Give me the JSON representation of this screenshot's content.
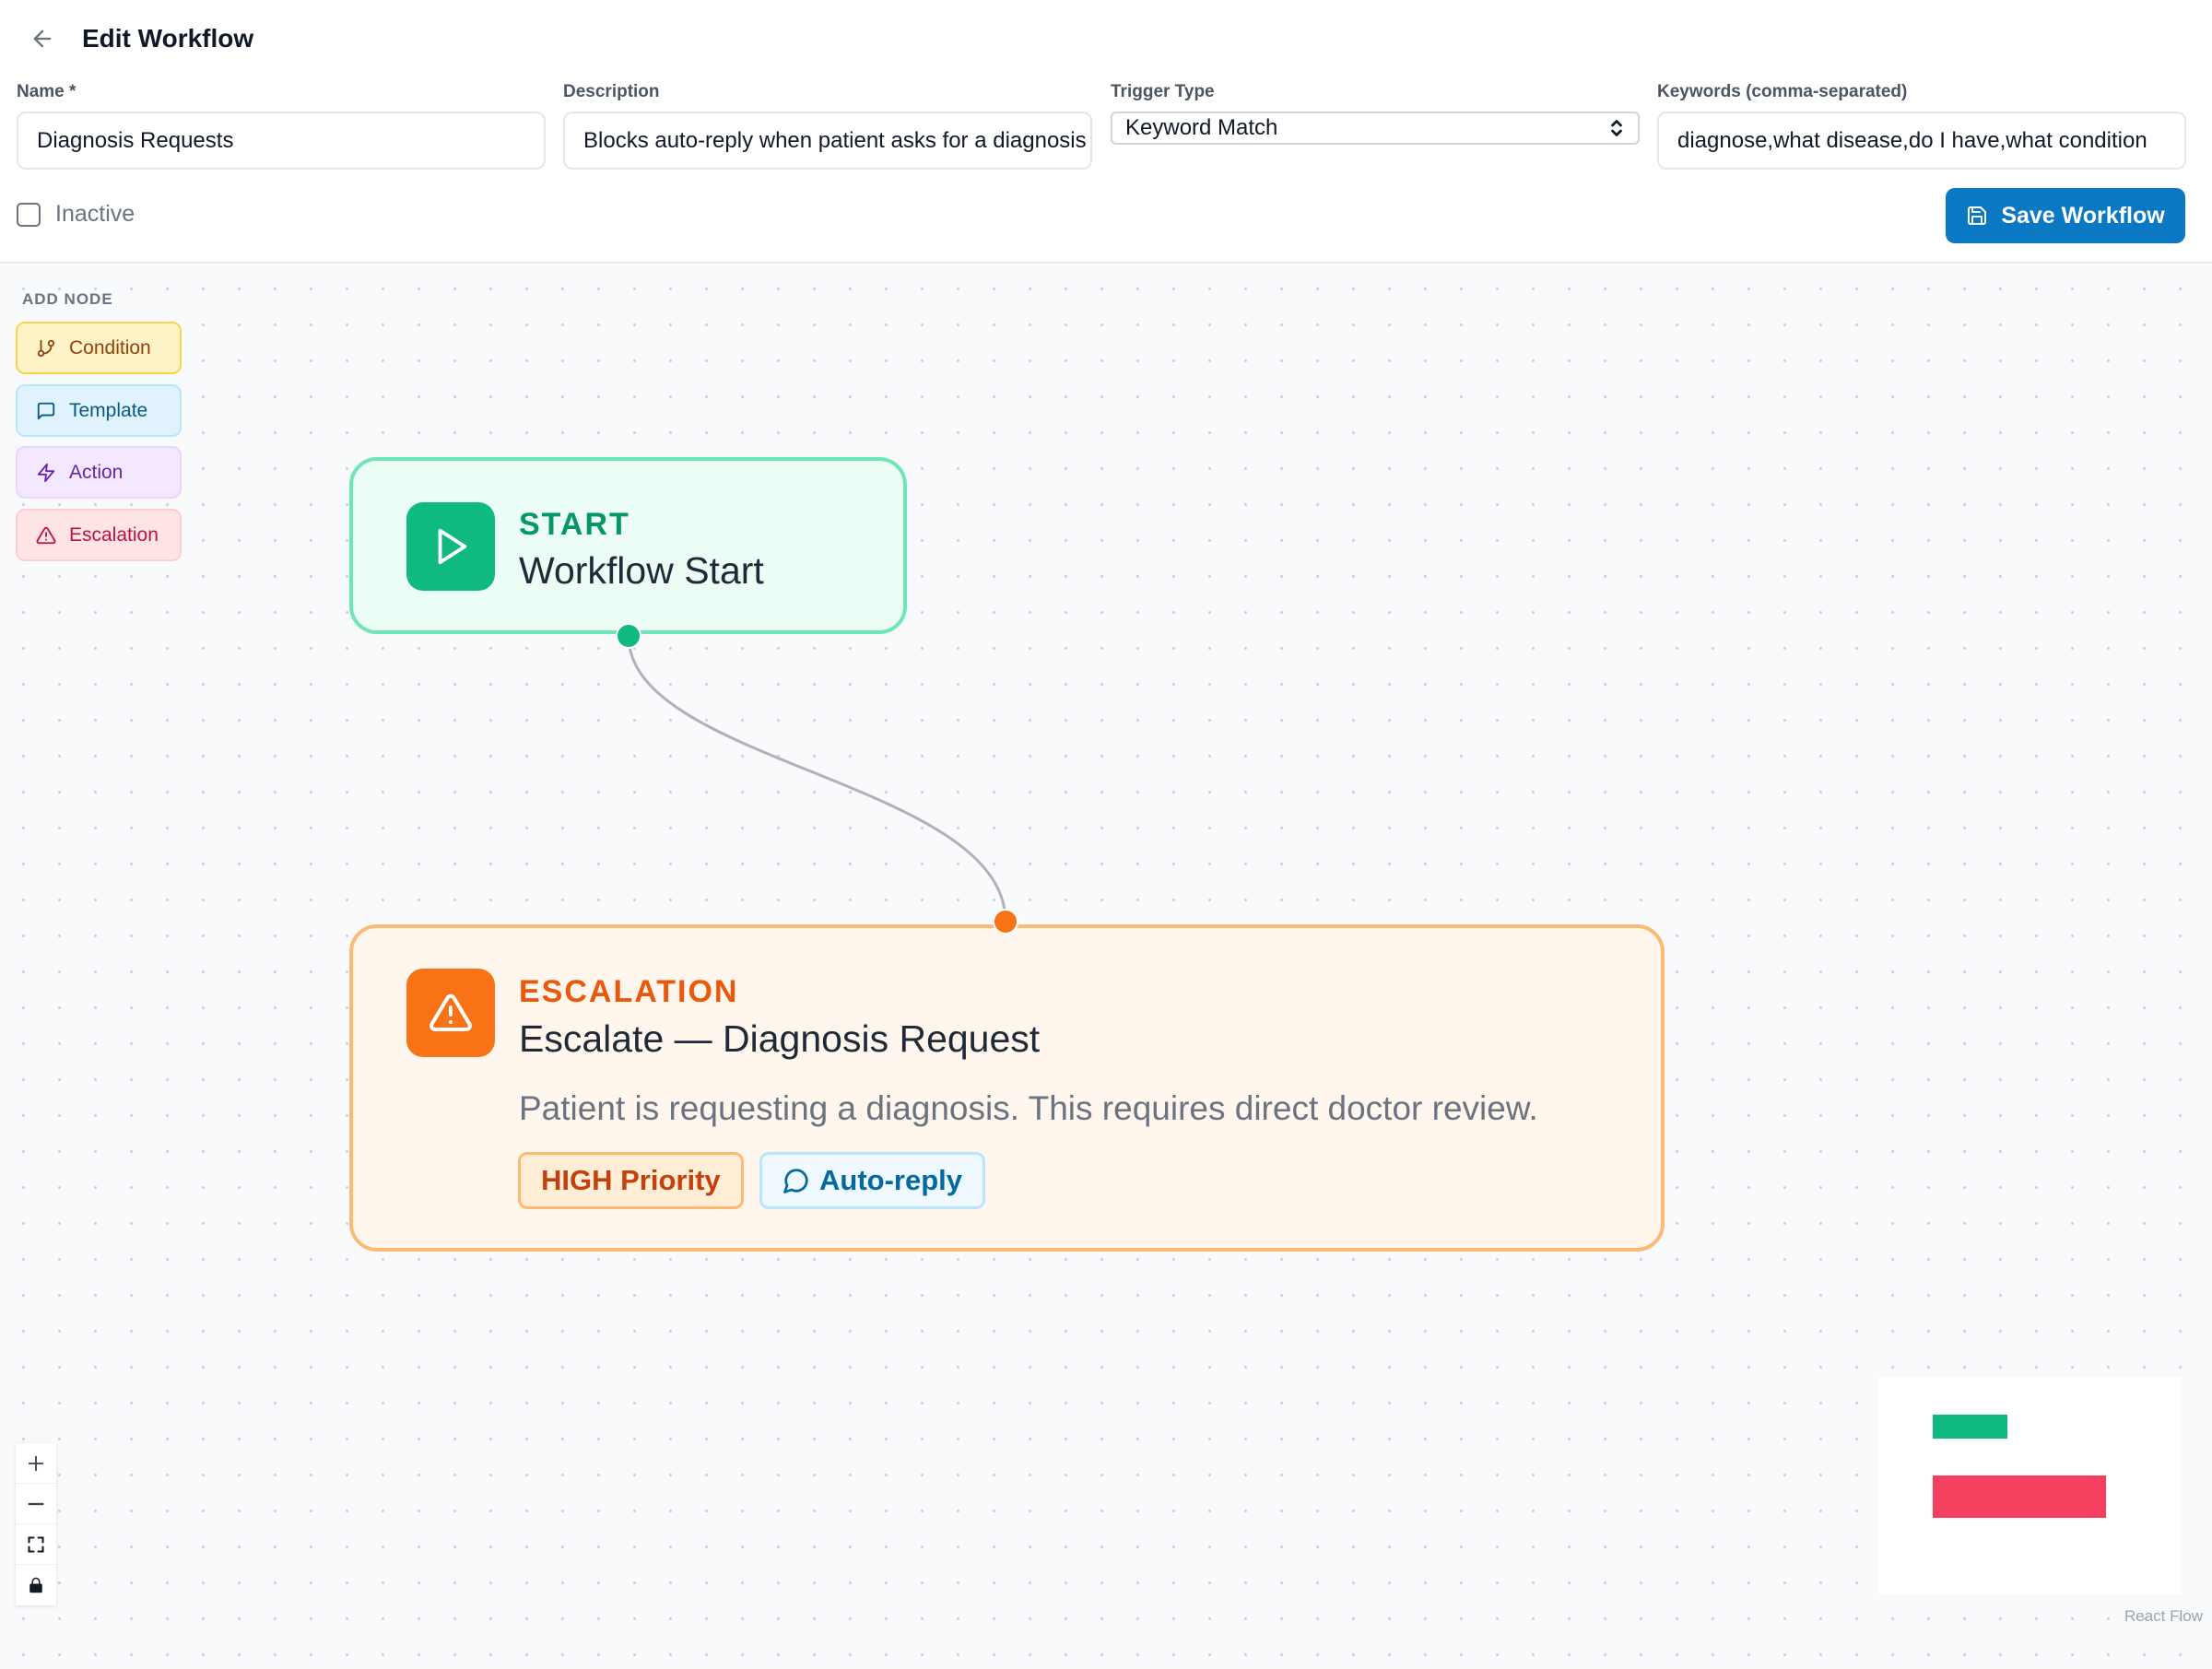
{
  "header": {
    "title": "Edit Workflow",
    "name_label": "Name *",
    "name_value": "Diagnosis Requests",
    "description_label": "Description",
    "description_value": "Blocks auto-reply when patient asks for a diagnosis",
    "trigger_label": "Trigger Type",
    "trigger_value": "Keyword Match",
    "keywords_label": "Keywords (comma-separated)",
    "keywords_value": "diagnose,what disease,do I have,what condition",
    "inactive_label": "Inactive",
    "save_label": "Save Workflow"
  },
  "palette": {
    "title": "ADD NODE",
    "items": [
      "Condition",
      "Template",
      "Action",
      "Escalation"
    ]
  },
  "nodes": {
    "start": {
      "type": "START",
      "label": "Workflow Start"
    },
    "escalation": {
      "type": "ESCALATION",
      "label": "Escalate — Diagnosis Request",
      "description": "Patient is requesting a diagnosis. This requires direct doctor review.",
      "priority_badge": "HIGH Priority",
      "autoreply_badge": "Auto-reply"
    }
  },
  "colors": {
    "primary": "#0a78c2",
    "start": "#10b981",
    "escalation": "#f97316",
    "minimap_escalation": "#f43f5e"
  },
  "attribution": "React Flow"
}
